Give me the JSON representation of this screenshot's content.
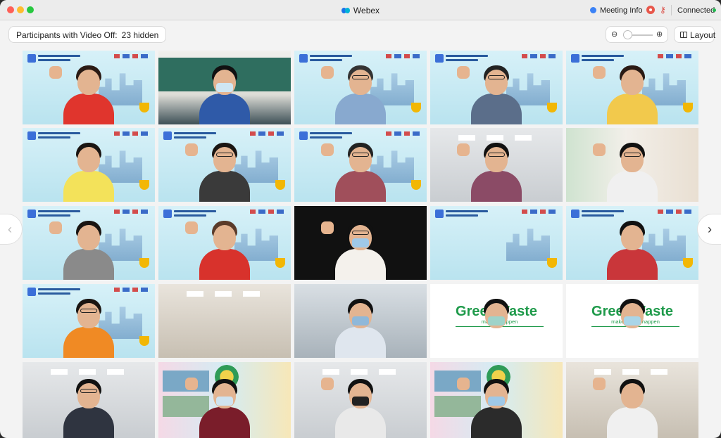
{
  "window": {
    "title": "Webex"
  },
  "titlebar": {
    "meeting_info_label": "Meeting Info",
    "status_label": "Connected",
    "status_color": "#1fb94e"
  },
  "toolbar": {
    "hidden_label": "Participants with Video Off:",
    "hidden_count": "23 hidden",
    "zoom_out_icon": "zoom-out-icon",
    "zoom_in_icon": "zoom-in-icon",
    "layout_label": "Layout"
  },
  "navigation": {
    "prev_icon": "chevron-left-icon",
    "next_icon": "chevron-right-icon"
  },
  "colors": {
    "accent": "#3b82f6",
    "green_brand": "#1e9a4a",
    "record": "#e8574b"
  },
  "tiles": [
    {
      "scene": "webinar",
      "shirt": "#e0352d",
      "hair": "#2a1a14",
      "raise": true
    },
    {
      "scene": "classroom",
      "shirt": "#2f5aa8",
      "hair": "#111",
      "mask": "#cfe6f2"
    },
    {
      "scene": "webinar",
      "shirt": "#88a9cf",
      "hair": "#333",
      "raise": true,
      "glasses": true
    },
    {
      "scene": "webinar",
      "shirt": "#5b6e8a",
      "hair": "#222",
      "raise": true,
      "glasses": true
    },
    {
      "scene": "webinar",
      "shirt": "#f2c94c",
      "hair": "#2a1a14",
      "raise": true
    },
    {
      "scene": "webinar",
      "shirt": "#f3e25a",
      "hair": "#1a1512"
    },
    {
      "scene": "webinar",
      "shirt": "#3a3a3a",
      "hair": "#1a1512",
      "raise": true,
      "glasses": true
    },
    {
      "scene": "webinar",
      "shirt": "#a04f5b",
      "hair": "#222",
      "raise": true,
      "glasses": true
    },
    {
      "scene": "office",
      "shirt": "#8b4b66",
      "hair": "#111",
      "raise": true,
      "glasses": true
    },
    {
      "scene": "window",
      "shirt": "#f0f0f0",
      "hair": "#111",
      "raise": true,
      "glasses": true
    },
    {
      "scene": "webinar",
      "shirt": "#8a8a8a",
      "hair": "#1a1512",
      "raise": true
    },
    {
      "scene": "webinar",
      "shirt": "#d8322c",
      "hair": "#5a3b2a",
      "raise": true
    },
    {
      "scene": "dark",
      "shirt": "#f4f1ec",
      "hair": "#111",
      "mask": "#9fc9e8",
      "glasses": true,
      "raise": true
    },
    {
      "scene": "webinar-empty"
    },
    {
      "scene": "webinar",
      "shirt": "#c9363a",
      "hair": "#111"
    },
    {
      "scene": "webinar",
      "shirt": "#f08a24",
      "hair": "#1a1512",
      "glasses": true
    },
    {
      "scene": "hall"
    },
    {
      "scene": "lab",
      "shirt": "#dfe6ee",
      "hair": "#111",
      "mask": "#8fb8d9"
    },
    {
      "scene": "greenwaste",
      "title": "GreenWaste",
      "subtitle": "make n",
      "subtitle2": "happen",
      "shirt": "#ffffff",
      "hair": "#111",
      "mask": "#9fd3c9"
    },
    {
      "scene": "greenwaste",
      "title": "GreenWaste",
      "subtitle": "make n",
      "subtitle2": "rden happen",
      "shirt": "#ffffff",
      "hair": "#111",
      "mask": "#a9d5e8"
    },
    {
      "scene": "office",
      "shirt": "#2f3440",
      "hair": "#111",
      "glasses": true
    },
    {
      "scene": "poster",
      "shirt": "#7a1d2a",
      "hair": "#111",
      "mask": "#cfe3f0",
      "raise": true
    },
    {
      "scene": "office",
      "shirt": "#e9e9e9",
      "hair": "#111",
      "mask": "#222",
      "raise": true
    },
    {
      "scene": "poster",
      "shirt": "#2b2b2b",
      "hair": "#111",
      "mask": "#9fc9e8",
      "raise": true
    },
    {
      "scene": "hall",
      "shirt": "#f0f0f0",
      "hair": "#111",
      "raise": true
    }
  ]
}
